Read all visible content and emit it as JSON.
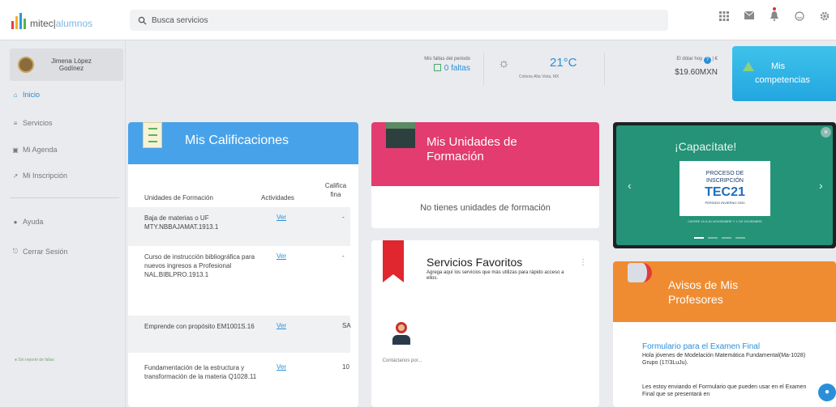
{
  "app": {
    "logo_prefix": "mitec|",
    "logo_suffix": "alumnos",
    "logo_colors": [
      "#e2433a",
      "#f3b02c",
      "#2a9ad6",
      "#59b44a"
    ]
  },
  "search": {
    "placeholder": "Busca servicios"
  },
  "top_icons": [
    "grid-icon",
    "mail-icon",
    "notification-icon",
    "smiley-icon",
    "settings-icon"
  ],
  "user": {
    "name": "Jimena López Godínez"
  },
  "sidebar": {
    "items": [
      {
        "label": "Inicio",
        "icon": "home-icon",
        "active": true
      },
      {
        "label": "Servicios",
        "icon": "list-icon"
      },
      {
        "label": "Mi Agenda",
        "icon": "calendar-icon"
      },
      {
        "label": "Mi Inscripción",
        "icon": "enroll-icon"
      },
      {
        "label": "Ayuda",
        "icon": "help-icon"
      },
      {
        "label": "Cerrar Sesión",
        "icon": "logout-icon"
      }
    ],
    "footer": "● Sin reporte de fallas"
  },
  "info": {
    "absences_label": "Mis faltas del periodo",
    "absences_value": "0 faltas",
    "temperature": "21°C",
    "location": "Colonia Alta Vista, MX",
    "dollar_label": "El dólar hoy",
    "dollar_value": "$19.60MXN",
    "competencias_line1": "Mis",
    "competencias_line2": "competencias"
  },
  "grades": {
    "title": "Mis Calificaciones",
    "col_unidades": "Unidades de Formación",
    "col_actividades": "Actividades",
    "col_calificacion": "Califica fina",
    "rows": [
      {
        "name": "Baja de materias o UF MTY.NBBAJAMAT.1913.1",
        "link": "Ver",
        "grade": "-"
      },
      {
        "name": "Curso de instrucción bibliográfica para nuevos ingresos a Profesional NAL.BIBLPRO.1913.1",
        "link": "Ver",
        "grade": "-"
      },
      {
        "name": "Emprende con propósito EM1001S.16",
        "link": "Ver",
        "grade": "SA"
      },
      {
        "name": "Fundamentación de la estructura y transformación de la materia Q1028.11",
        "link": "Ver",
        "grade": "10"
      }
    ]
  },
  "unidades": {
    "title": "Mis Unidades de Formación",
    "empty": "No tienes unidades de formación"
  },
  "favoritos": {
    "title": "Servicios Favoritos",
    "description": "Agrega aquí los servicios que más utilizas para rápido acceso a ellos.",
    "more": "⋮",
    "contact_label": "Contáctanos por..."
  },
  "carousel": {
    "capacitate": "¡Capacítate!",
    "line1": "PROCESO DE INSCRIPCIÓN",
    "brand": "TEC21",
    "subline": "PERIODO INVIERNO 2020",
    "date": "CIERRE 16 A 30 NOVIEMBRE Y 1 DE DICIEMBRE",
    "prev": "‹",
    "next": "›",
    "close": "×"
  },
  "avisos": {
    "title": "Avisos de Mis Profesores",
    "post_title": "Formulario para el Examen Final",
    "post_body": "Hola jóvenes de Modelación Matemática Fundamental(Ma-1028) Grupo (17/3LuJu).",
    "post_body2": "Les estoy enviando el Formulario que pueden usar en el Examen Final que se presentará en"
  }
}
